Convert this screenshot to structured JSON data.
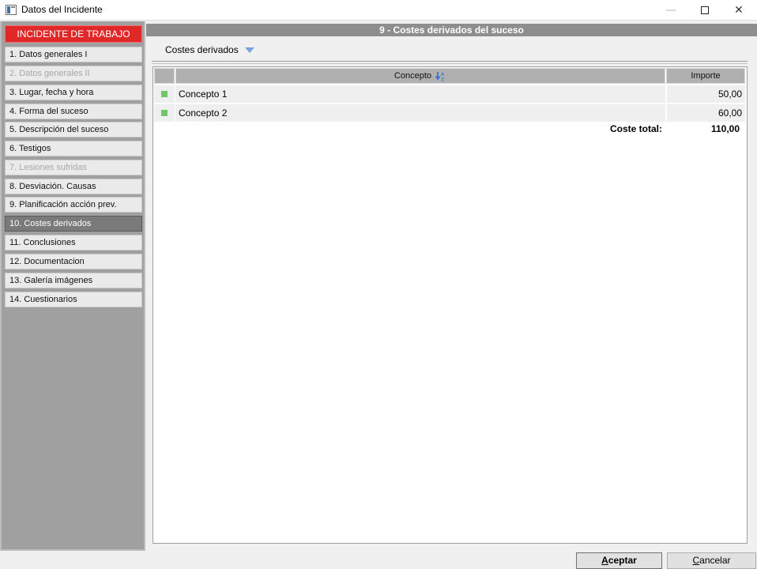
{
  "window": {
    "title": "Datos del Incidente",
    "controls": [
      "minimize-icon",
      "maximize-icon",
      "close-icon"
    ]
  },
  "sidebar": {
    "header": "INCIDENTE DE TRABAJO",
    "items": [
      {
        "label": "1. Datos generales I",
        "state": "normal"
      },
      {
        "label": "2. Datos generales II",
        "state": "disabled"
      },
      {
        "label": "3. Lugar, fecha y hora",
        "state": "normal"
      },
      {
        "label": "4. Forma del suceso",
        "state": "normal"
      },
      {
        "label": "5. Descripción del suceso",
        "state": "normal"
      },
      {
        "label": "6. Testigos",
        "state": "normal"
      },
      {
        "label": "7. Lesiones sufridas",
        "state": "disabled"
      },
      {
        "label": "8. Desviación. Causas",
        "state": "normal"
      },
      {
        "label": "9. Planificación acción prev.",
        "state": "normal"
      },
      {
        "label": "10. Costes derivados",
        "state": "active"
      },
      {
        "label": "11. Conclusiones",
        "state": "normal"
      },
      {
        "label": "12. Documentacion",
        "state": "normal"
      },
      {
        "label": "13. Galería imágenes",
        "state": "normal"
      },
      {
        "label": "14. Cuestionarios",
        "state": "normal"
      }
    ]
  },
  "main": {
    "section_title": "9 - Costes derivados del suceso",
    "dropdown_label": "Costes derivados",
    "table": {
      "columns": [
        "Concepto",
        "Importe"
      ],
      "rows": [
        {
          "concepto": "Concepto 1",
          "importe": "50,00"
        },
        {
          "concepto": "Concepto 2",
          "importe": "60,00"
        }
      ],
      "total_label": "Coste total:",
      "total_value": "110,00"
    }
  },
  "buttons": {
    "accept_mnemonic": "A",
    "accept_rest": "ceptar",
    "cancel_mnemonic": "C",
    "cancel_rest": "ancelar"
  },
  "colors": {
    "sidebar_header_bg": "#e02828",
    "active_item_bg": "#7a7a7a",
    "row_marker": "#6ec86a",
    "dropdown_arrow": "#7aa2d8"
  }
}
